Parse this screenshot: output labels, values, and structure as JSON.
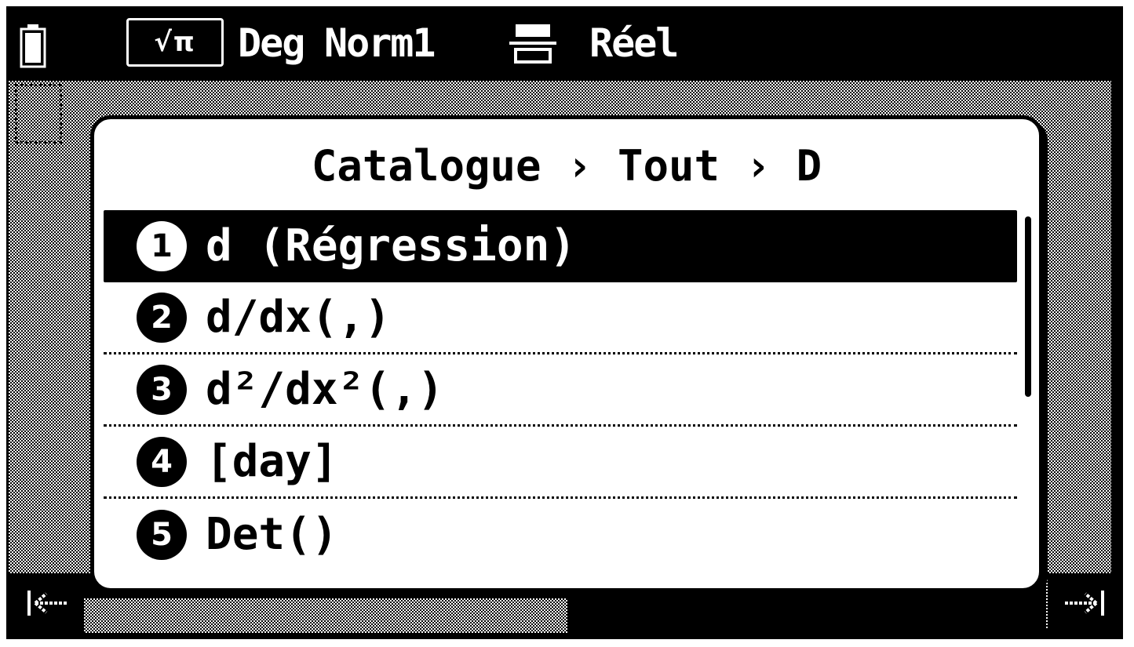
{
  "status_bar": {
    "battery_icon": "battery-full-icon",
    "mode_label": "√π",
    "angle_unit": "Deg",
    "display_format": "Norm1",
    "fraction_icon": "fraction-format-icon",
    "number_system": "Réel"
  },
  "dialog": {
    "title": "Catalogue › Tout › D",
    "items": [
      {
        "number": "1",
        "label": "d (Régression)",
        "selected": true
      },
      {
        "number": "2",
        "label": "d/dx(,)",
        "selected": false
      },
      {
        "number": "3",
        "label": "d²/dx²(,)",
        "selected": false
      },
      {
        "number": "4",
        "label": "[day]",
        "selected": false
      },
      {
        "number": "5",
        "label": "Det()",
        "selected": false
      }
    ],
    "scroll_position": 0
  },
  "softkeys": {
    "left_icon": "arrow-left-to-bar-icon",
    "right_icon": "arrow-right-to-bar-icon"
  },
  "colors": {
    "foreground": "#000000",
    "background": "#ffffff"
  }
}
